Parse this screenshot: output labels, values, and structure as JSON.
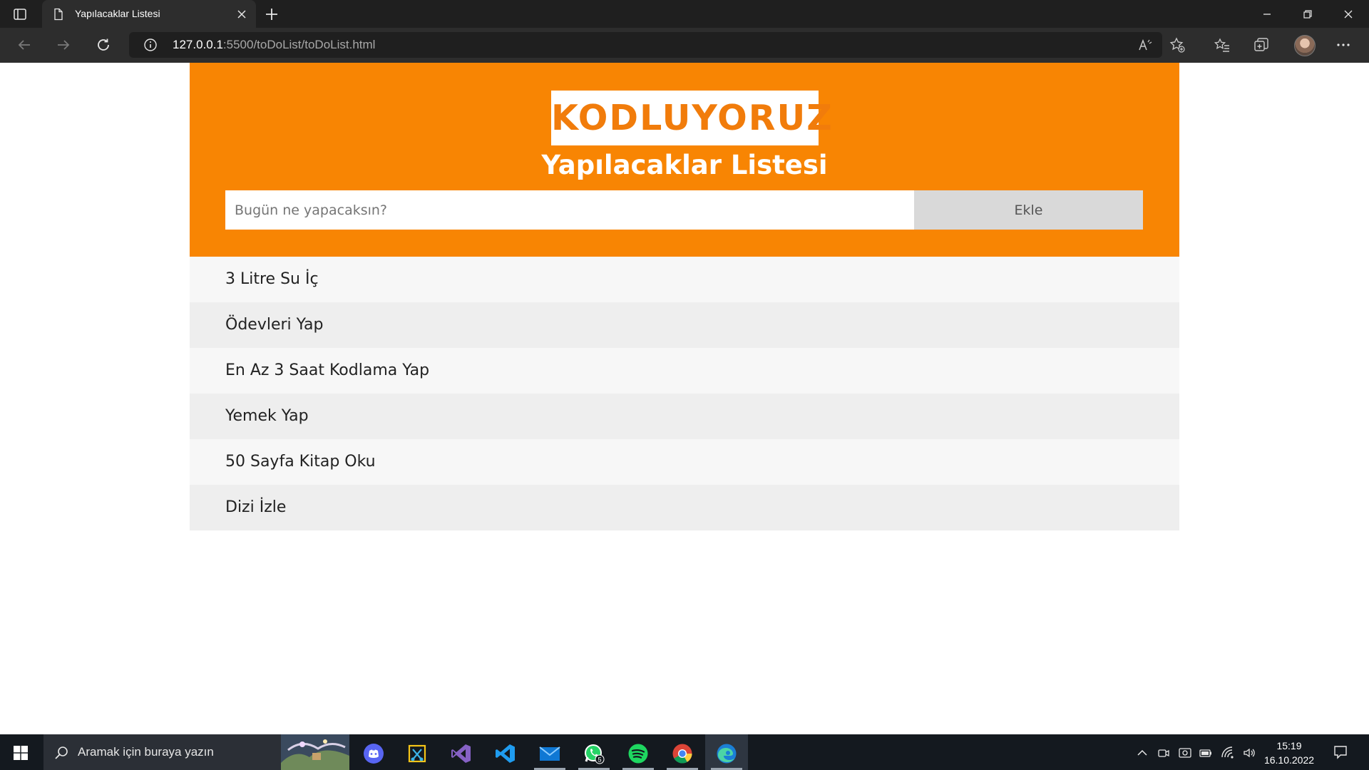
{
  "browser": {
    "tab": {
      "title": "Yapılacaklar Listesi"
    },
    "address": {
      "host": "127.0.0.1",
      "path": ":5500/toDoList/toDoList.html"
    }
  },
  "app": {
    "logo_text": "KODLUYORUZ",
    "title": "Yapılacaklar Listesi",
    "input": {
      "placeholder": "Bugün ne yapacaksın?",
      "value": ""
    },
    "add_button_label": "Ekle",
    "todos": [
      "3 Litre Su İç",
      "Ödevleri Yap",
      "En Az 3 Saat Kodlama Yap",
      "Yemek Yap",
      "50 Sayfa Kitap Oku",
      "Dizi İzle"
    ]
  },
  "taskbar": {
    "search_placeholder": "Aramak için buraya yazın",
    "apps": [
      "discord-icon",
      "snipping-tool-icon",
      "visual-studio-icon",
      "vscode-icon",
      "mail-icon",
      "whatsapp-icon",
      "spotify-icon",
      "chrome-icon",
      "edge-icon"
    ],
    "whatsapp_badge": "5",
    "time": "15:19",
    "date": "16.10.2022"
  },
  "colors": {
    "header_orange": "#f88503",
    "logo_orange": "#f17c0b",
    "add_button_bg": "#d9d9d9"
  }
}
